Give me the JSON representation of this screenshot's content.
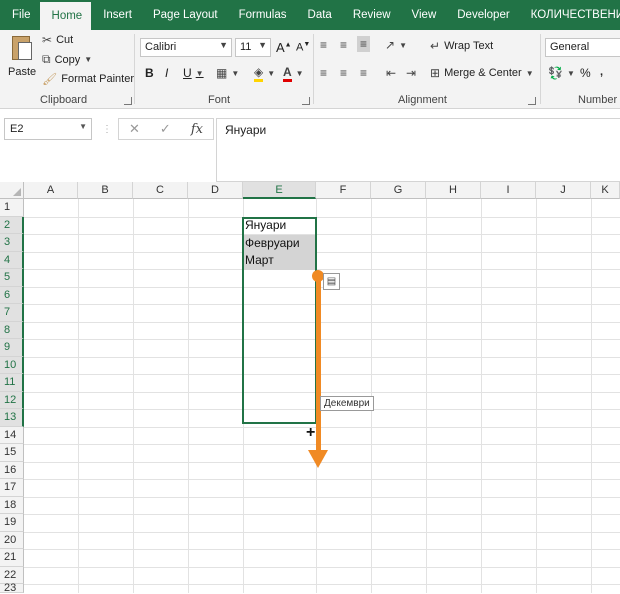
{
  "tabs": [
    "File",
    "Home",
    "Insert",
    "Page Layout",
    "Formulas",
    "Data",
    "Review",
    "View",
    "Developer",
    "КОЛИЧЕСТВЕНИ"
  ],
  "active_tab": "Home",
  "clipboard": {
    "paste": "Paste",
    "cut": "Cut",
    "copy": "Copy",
    "format_painter": "Format Painter",
    "label": "Clipboard"
  },
  "font": {
    "name": "Calibri",
    "size": "11",
    "bold": "B",
    "italic": "I",
    "underline": "U",
    "label": "Font"
  },
  "alignment": {
    "wrap_text": "Wrap Text",
    "merge_center": "Merge & Center",
    "label": "Alignment"
  },
  "number": {
    "format": "General",
    "percent": "%",
    "label": "Number"
  },
  "formula_bar": {
    "name_box": "E2",
    "fx": "fx",
    "content": "Януари"
  },
  "columns": [
    "A",
    "B",
    "C",
    "D",
    "E",
    "F",
    "G",
    "H",
    "I",
    "J",
    "K"
  ],
  "selected_column": "E",
  "rows": [
    "1",
    "2",
    "3",
    "4",
    "5",
    "6",
    "7",
    "8",
    "9",
    "10",
    "11",
    "12",
    "13",
    "14",
    "15",
    "16",
    "17",
    "18",
    "19",
    "20",
    "21",
    "22",
    "23"
  ],
  "cells": {
    "E2": "Януари",
    "E3": "Февруари",
    "E4": "Март"
  },
  "autofill_tooltip": "Декември",
  "colors": {
    "accent": "#217346",
    "arrow": "#f08a24",
    "fill_highlight": "#d4d4d4"
  }
}
